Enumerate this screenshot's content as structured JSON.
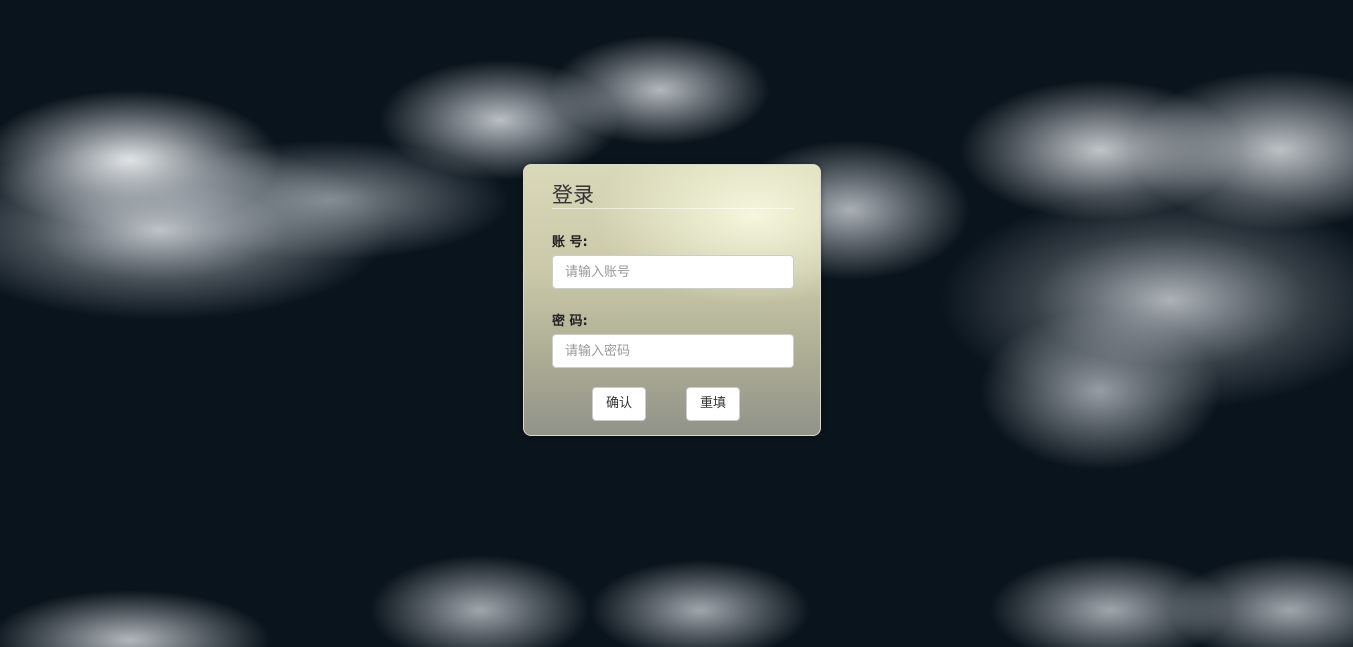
{
  "login": {
    "title": "登录",
    "account_label": "账 号:",
    "account_placeholder": "请输入账号",
    "account_value": "",
    "password_label": "密 码:",
    "password_placeholder": "请输入密码",
    "password_value": "",
    "confirm_label": "确认",
    "reset_label": "重填"
  },
  "colors": {
    "background": "#0a141c",
    "panel": "#c9c8a8",
    "text": "#333333"
  }
}
